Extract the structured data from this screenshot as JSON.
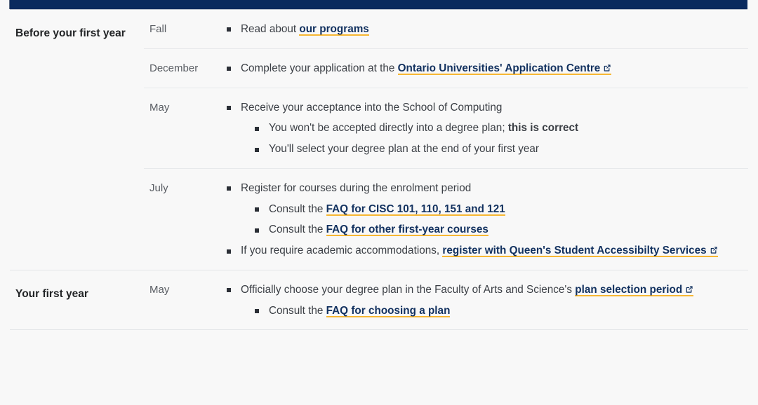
{
  "page": {
    "accent_navy": "#0a2a5e",
    "link_navy": "#12315f",
    "underline_gold": "#f7b733",
    "body_text": "#3b3f45",
    "muted_text": "#595d63"
  },
  "sections": [
    {
      "label": "Before your first year",
      "rows": [
        {
          "month": "Fall",
          "items": [
            {
              "parts": [
                {
                  "type": "text",
                  "text": "Read about "
                },
                {
                  "type": "link",
                  "text": "our programs",
                  "external": false
                }
              ],
              "children": []
            }
          ]
        },
        {
          "month": "December",
          "items": [
            {
              "parts": [
                {
                  "type": "text",
                  "text": "Complete your application at the "
                },
                {
                  "type": "link",
                  "text": "Ontario Universities' Application Centre",
                  "external": true
                }
              ],
              "children": []
            }
          ]
        },
        {
          "month": "May",
          "items": [
            {
              "parts": [
                {
                  "type": "text",
                  "text": "Receive your acceptance into the School of Computing"
                }
              ],
              "children": [
                {
                  "parts": [
                    {
                      "type": "text",
                      "text": "You won't be accepted directly into a degree plan; "
                    },
                    {
                      "type": "strong",
                      "text": "this is correct"
                    }
                  ]
                },
                {
                  "parts": [
                    {
                      "type": "text",
                      "text": "You'll select your degree plan at the end of your first year"
                    }
                  ]
                }
              ]
            }
          ]
        },
        {
          "month": "July",
          "items": [
            {
              "parts": [
                {
                  "type": "text",
                  "text": "Register for courses during the enrolment period"
                }
              ],
              "children": [
                {
                  "parts": [
                    {
                      "type": "text",
                      "text": "Consult the "
                    },
                    {
                      "type": "link",
                      "text": "FAQ for CISC 101, 110, 151 and 121",
                      "external": false
                    }
                  ]
                },
                {
                  "parts": [
                    {
                      "type": "text",
                      "text": "Consult the "
                    },
                    {
                      "type": "link",
                      "text": "FAQ for other first-year courses",
                      "external": false
                    }
                  ]
                }
              ]
            },
            {
              "parts": [
                {
                  "type": "text",
                  "text": "If you require academic accommodations, "
                },
                {
                  "type": "link",
                  "text": "register with Queen's Student Accessibilty Services",
                  "external": true
                }
              ],
              "children": []
            }
          ]
        }
      ]
    },
    {
      "label": "Your first year",
      "rows": [
        {
          "month": "May",
          "items": [
            {
              "parts": [
                {
                  "type": "text",
                  "text": "Officially choose your degree plan in the Faculty of Arts and Science's "
                },
                {
                  "type": "link",
                  "text": "plan selection period",
                  "external": true
                }
              ],
              "children": [
                {
                  "parts": [
                    {
                      "type": "text",
                      "text": "Consult the "
                    },
                    {
                      "type": "link",
                      "text": "FAQ for choosing a plan",
                      "external": false
                    }
                  ]
                }
              ]
            }
          ]
        }
      ]
    }
  ],
  "icons": {
    "external_link": "external-link-icon",
    "bullet": "bullet-square-icon"
  }
}
